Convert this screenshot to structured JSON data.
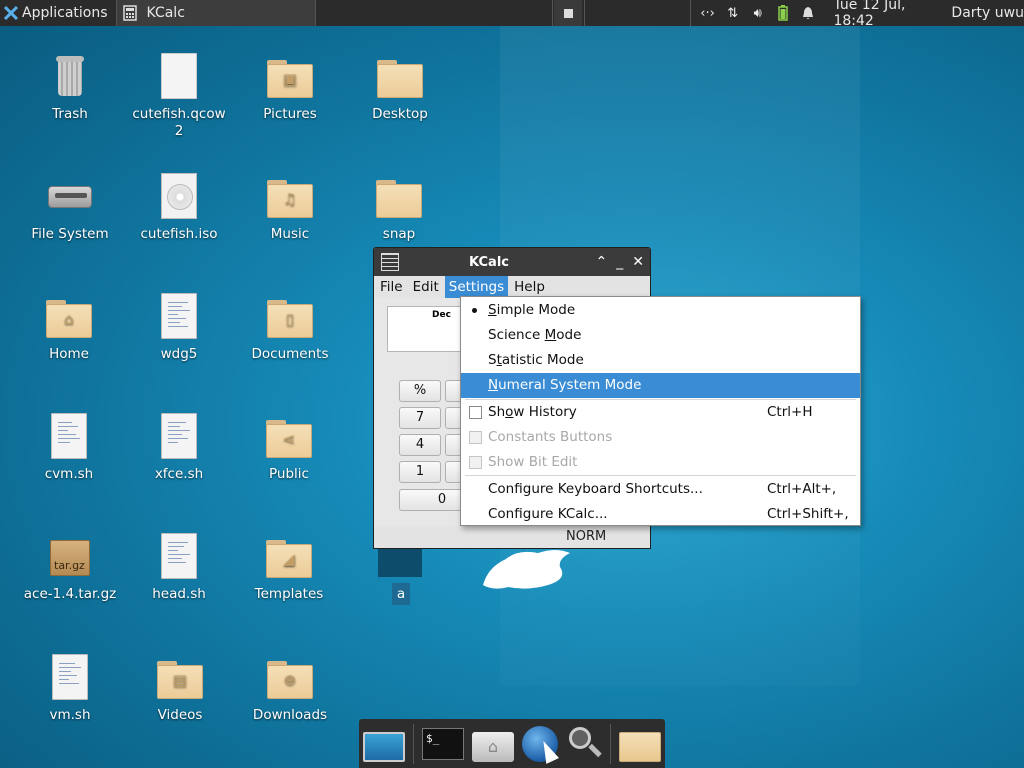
{
  "panel": {
    "apps_label": "Applications",
    "task_label": "KCalc",
    "clock": "Tue 12 Jul, 18:42",
    "user": "Darty uwu"
  },
  "desktop": {
    "icons": [
      {
        "label": "Trash",
        "kind": "trash"
      },
      {
        "label": "cutefish.qcow2",
        "kind": "blank-file"
      },
      {
        "label": "Pictures",
        "kind": "folder-pictures"
      },
      {
        "label": "Desktop",
        "kind": "folder"
      },
      {
        "label": "File System",
        "kind": "drive"
      },
      {
        "label": "cutefish.iso",
        "kind": "disc-image"
      },
      {
        "label": "Music",
        "kind": "folder-music"
      },
      {
        "label": "snap",
        "kind": "folder"
      },
      {
        "label": "Home",
        "kind": "folder-home"
      },
      {
        "label": "wdg5",
        "kind": "text-file"
      },
      {
        "label": "Documents",
        "kind": "folder-documents"
      },
      {
        "label": "cvm.sh",
        "kind": "script-file"
      },
      {
        "label": "xfce.sh",
        "kind": "script-file"
      },
      {
        "label": "Public",
        "kind": "folder-public"
      },
      {
        "label": "ace-1.4.tar.gz",
        "kind": "archive"
      },
      {
        "label": "head.sh",
        "kind": "script-file"
      },
      {
        "label": "Templates",
        "kind": "folder-templates"
      },
      {
        "label": "vm.sh",
        "kind": "script-file"
      },
      {
        "label": "Videos",
        "kind": "folder-videos"
      },
      {
        "label": "Downloads",
        "kind": "folder-downloads"
      }
    ],
    "selected_label": "a",
    "archive_badge": "tar.gz",
    "cutefish_qcow_line1": "cutefish.qcow",
    "cutefish_qcow_line2": "2"
  },
  "kcalc": {
    "title": "KCalc",
    "menu": [
      "File",
      "Edit",
      "Settings",
      "Help"
    ],
    "display_base": "Dec",
    "keys": [
      "%",
      "7",
      "4",
      "1",
      "0"
    ],
    "status": "NORM"
  },
  "settings_menu": {
    "items": [
      {
        "label": "Simple Mode",
        "mnemonic_index": 0,
        "type": "radio",
        "checked": true,
        "shortcut": ""
      },
      {
        "label": "Science Mode",
        "mnemonic_index": 8,
        "type": "radio",
        "checked": false,
        "shortcut": ""
      },
      {
        "label": "Statistic Mode",
        "mnemonic_index": 1,
        "type": "radio",
        "checked": false,
        "shortcut": ""
      },
      {
        "label": "Numeral System Mode",
        "mnemonic_index": 0,
        "type": "radio",
        "checked": false,
        "shortcut": "",
        "highlighted": true
      },
      {
        "label": "Show History",
        "mnemonic_index": 2,
        "type": "check",
        "checked": false,
        "shortcut": "Ctrl+H"
      },
      {
        "label": "Constants Buttons",
        "type": "check",
        "checked": false,
        "shortcut": "",
        "disabled": true
      },
      {
        "label": "Show Bit Edit",
        "type": "check",
        "checked": false,
        "shortcut": "",
        "disabled": true
      },
      {
        "label": "Configure Keyboard Shortcuts...",
        "type": "action",
        "shortcut": "Ctrl+Alt+,"
      },
      {
        "label": "Configure KCalc...",
        "type": "action",
        "shortcut": "Ctrl+Shift+,"
      }
    ]
  },
  "dock": {
    "items": [
      "monitor-icon",
      "terminal-icon",
      "home-icon",
      "browser-icon",
      "search-icon",
      "folder-icon"
    ],
    "terminal_glyph": "$_"
  },
  "colors": {
    "highlight": "#3a8dd4",
    "panel": "#2b2b2b",
    "wallpaper": "#1689b6"
  }
}
